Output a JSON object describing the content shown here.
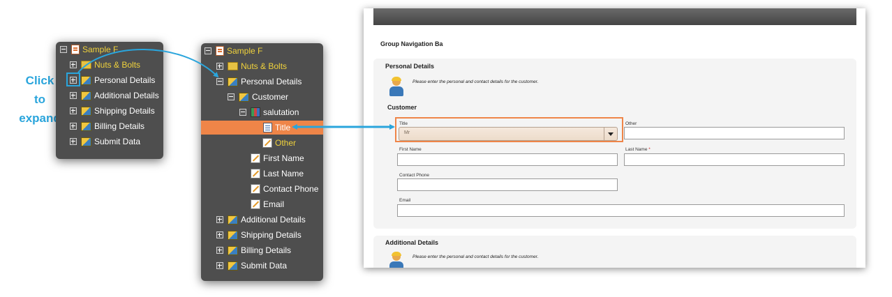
{
  "annotation": {
    "click_note": [
      "Click",
      "to",
      "expand"
    ],
    "accent_color": "#2aa5dc"
  },
  "tree_small": {
    "root": "Sample F",
    "items": [
      "Nuts & Bolts",
      "Personal Details",
      "Additional Details",
      "Shipping Details",
      "Billing Details",
      "Submit Data"
    ]
  },
  "tree_big": {
    "root": "Sample F",
    "nuts": "Nuts & Bolts",
    "personal": "Personal Details",
    "customer": "Customer",
    "salutation": "salutation",
    "title": "Title",
    "other": "Other",
    "first_name": "First Name",
    "last_name": "Last Name",
    "contact_phone": "Contact Phone",
    "email": "Email",
    "additional": "Additional Details",
    "shipping": "Shipping Details",
    "billing": "Billing Details",
    "submit": "Submit Data",
    "selected_color": "#ef8548"
  },
  "form": {
    "title": "Group Navigation Ba",
    "section1_title": "Personal Details",
    "hint": "Please enter the personal and contact details for the customer.",
    "customer_title": "Customer",
    "title_label": "Title",
    "title_value": "Mr",
    "other_label": "Other",
    "first_name_label": "First Name",
    "last_name_label": "Last Name",
    "required_mark": "*",
    "contact_phone_label": "Contact Phone",
    "email_label": "Email",
    "section2_title": "Additional Details",
    "section2_hint": "Please enter the personal and contact details for the customer."
  }
}
